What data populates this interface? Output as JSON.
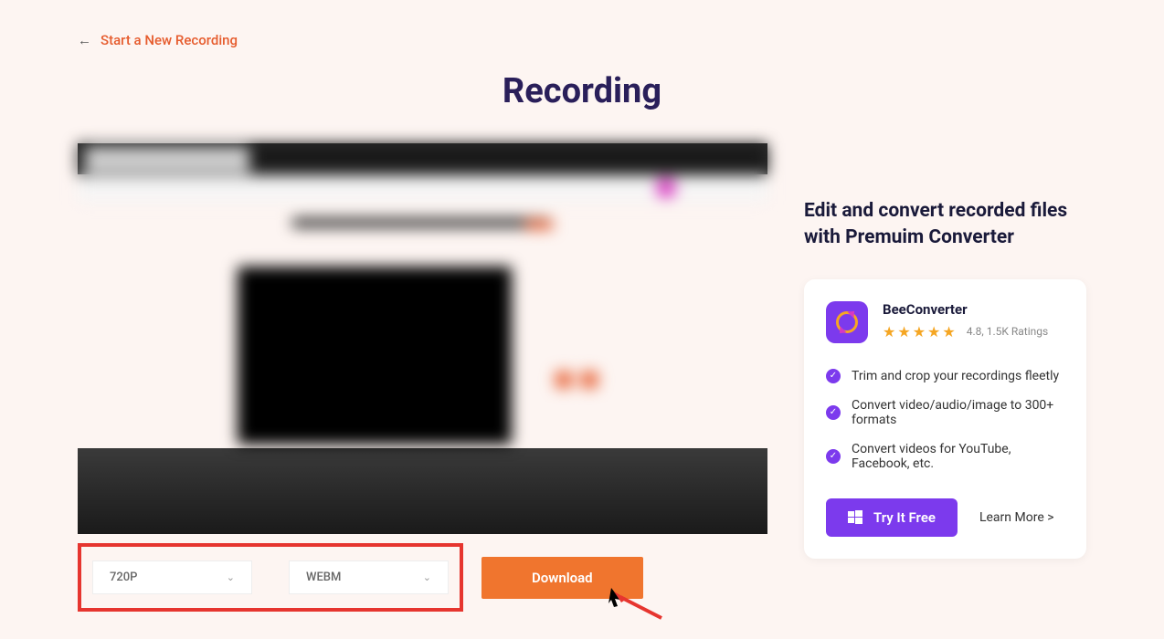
{
  "backLink": "Start a New Recording",
  "pageTitle": "Recording",
  "resolution": {
    "selected": "720P"
  },
  "format": {
    "selected": "WEBM"
  },
  "downloadLabel": "Download",
  "promo": {
    "heading": "Edit and convert recorded files with Premuim Converter",
    "productName": "BeeConverter",
    "rating": "4.8, 1.5K Ratings",
    "features": [
      "Trim and crop your recordings fleetly",
      "Convert video/audio/image to 300+ formats",
      "Convert videos for YouTube, Facebook, etc."
    ],
    "tryFreeLabel": "Try It Free",
    "learnMoreLabel": "Learn More >"
  }
}
